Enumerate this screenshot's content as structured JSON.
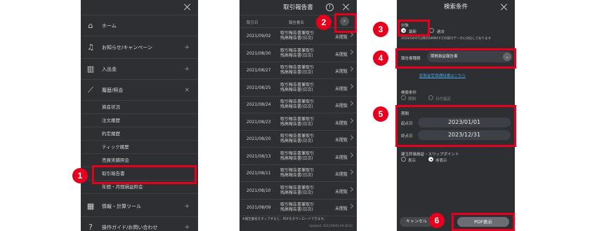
{
  "menu_screen": {
    "items": [
      {
        "icon": "home-icon",
        "label": "ホーム",
        "expand": ""
      },
      {
        "icon": "bell-icon",
        "label": "お知らせ/キャンペーン",
        "expand": "+"
      },
      {
        "icon": "bank-icon",
        "label": "入出金",
        "expand": "+"
      },
      {
        "icon": "chart-icon",
        "label": "履歴/照会",
        "expand": "×"
      }
    ],
    "sub_items": [
      "資産状況",
      "注文履歴",
      "約定履歴",
      "ティック履歴",
      "売買実績照会",
      "取引報告書",
      "年間・月間損益照会"
    ],
    "bottom_items": [
      {
        "icon": "calculator-icon",
        "label": "情報・計算ツール",
        "expand": "+"
      },
      {
        "icon": "question-icon",
        "label": "操作ガイド/お問い合わせ",
        "expand": "+"
      }
    ]
  },
  "report_screen": {
    "title": "取引報告書",
    "col_date": "取引日",
    "col_name": "報告書名",
    "rows": [
      {
        "date": "2021/09/02",
        "name": "取引報告書兼取引残高報告書(日次)",
        "status": "未閲覧"
      },
      {
        "date": "2021/08/30",
        "name": "取引報告書兼取引残高報告書(日次)",
        "status": "未閲覧"
      },
      {
        "date": "2021/08/27",
        "name": "取引報告書兼取引残高報告書(日次)",
        "status": "未閲覧"
      },
      {
        "date": "2021/08/25",
        "name": "取引報告書兼取引残高報告書(日次)",
        "status": "未閲覧"
      },
      {
        "date": "2021/08/24",
        "name": "取引報告書兼取引残高報告書(日次)",
        "status": "未閲覧"
      },
      {
        "date": "2021/08/23",
        "name": "取引報告書兼取引残高報告書(日次)",
        "status": "未閲覧"
      },
      {
        "date": "2021/08/20",
        "name": "取引報告書兼取引残高報告書(日次)",
        "status": "未閲覧"
      },
      {
        "date": "2021/08/13",
        "name": "取引報告書兼取引残高報告書(日次)",
        "status": "未閲覧"
      },
      {
        "date": "2021/08/11",
        "name": "取引報告書兼取引残高報告書(日次)",
        "status": "未閲覧"
      },
      {
        "date": "2021/08/10",
        "name": "取引報告書兼取引残高報告書(日次)",
        "status": "未閲覧"
      },
      {
        "date": "2021/08/09",
        "name": "取引報告書兼取引残高報告書(日次)",
        "status": "未閲覧"
      }
    ],
    "footer": "※報告書名をタップすると、PDFをダウンロードできます。",
    "updated": "Updated: 2021/09/03 09:30:42"
  },
  "search_screen": {
    "title": "検索条件",
    "target_label": "対象",
    "opt_latest": "最新",
    "opt_past": "過去",
    "note": "2020/04/07以降のDMMFXでの取引データに対応しております",
    "type_label": "報告書種類",
    "type_value": "期間損益報告書",
    "link": "証拠金受領通知書はこちら",
    "cond_label": "検索条件",
    "cond_opt1": "期間",
    "cond_opt2": "日付指定",
    "period_label": "期間",
    "start_label": "起点日",
    "start_value": "2023/01/01",
    "end_label": "終点日",
    "end_value": "2023/12/31",
    "swap_label": "建玉評価損益・スワップポイント",
    "swap_show": "表示",
    "swap_hide": "非表示",
    "cancel": "キャンセル",
    "pdf": "PDF表示"
  },
  "badges": [
    "1",
    "2",
    "3",
    "4",
    "5",
    "6"
  ],
  "colors": {
    "accent": "#e6001e",
    "bg": "#2d2f33"
  }
}
